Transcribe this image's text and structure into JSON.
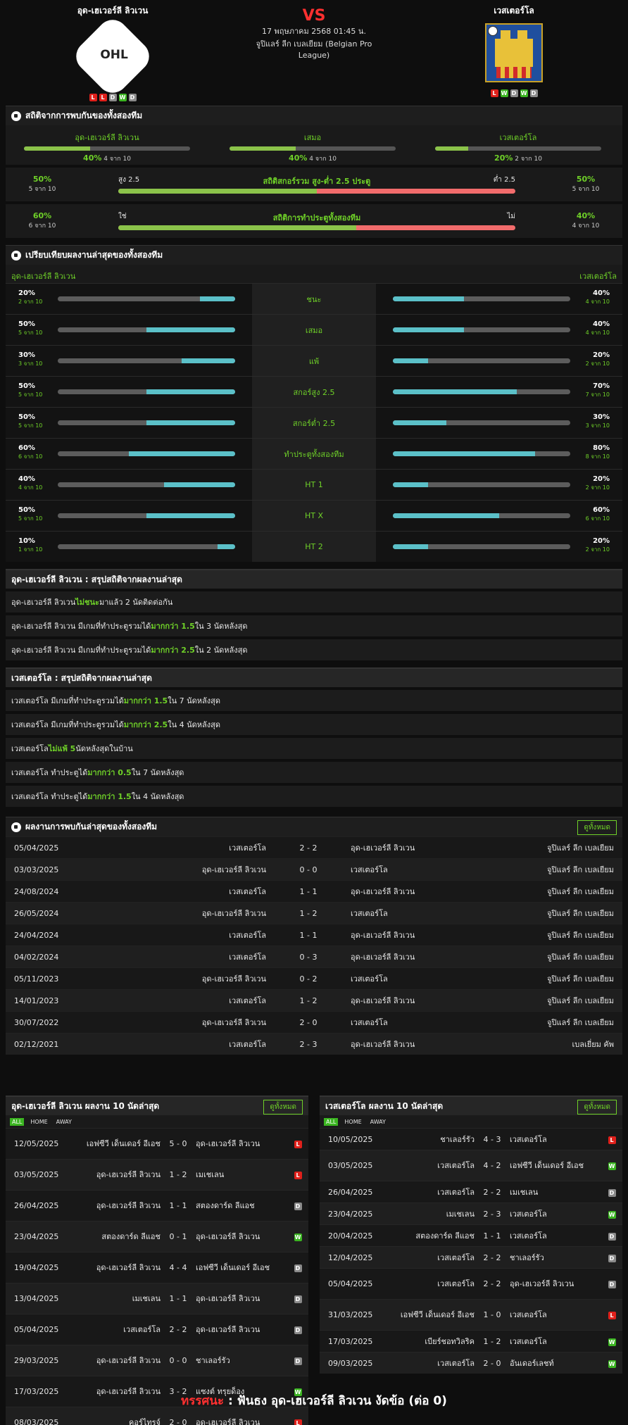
{
  "home": {
    "name": "อุด-เฮเวอร์ลี ลิวเวน",
    "logo_text": "OHL",
    "form": [
      "L",
      "L",
      "D",
      "W",
      "D"
    ]
  },
  "away": {
    "name": "เวสเตอร์โล",
    "form": [
      "L",
      "W",
      "D",
      "W",
      "D"
    ]
  },
  "match": {
    "vs": "VS",
    "date": "17 พฤษภาคม 2568 01:45 น.",
    "league": "จูปิแลร์ ลีก เบลเยียม (Belgian Pro League)"
  },
  "h2h_stats": {
    "title": "สถิติจากการพบกันของทั้งสองทีม",
    "cols": [
      {
        "label": "อุด-เฮเวอร์ลี ลิวเวน",
        "pct": "40%",
        "of": "4 จาก 10",
        "value": 0.4
      },
      {
        "label": "เสมอ",
        "pct": "40%",
        "of": "4 จาก 10",
        "value": 0.4
      },
      {
        "label": "เวสเตอร์โล",
        "pct": "20%",
        "of": "2 จาก 10",
        "value": 0.2
      }
    ],
    "ou": {
      "lp": "50%",
      "lof": "5 จาก 10",
      "rp": "50%",
      "rof": "5 จาก 10",
      "title": "สถิติสกอร์รวม สูง-ต่ำ 2.5 ประตู",
      "left": "สูง 2.5",
      "right": "ต่ำ 2.5",
      "value": 0.5
    },
    "bts": {
      "lp": "60%",
      "lof": "6 จาก 10",
      "rp": "40%",
      "rof": "4 จาก 10",
      "title": "สถิติการทำประตูทั้งสองทีม",
      "left": "ใช่",
      "right": "ไม่",
      "value": 0.6
    }
  },
  "compare": {
    "title": "เปรียบเทียบผลงานล่าสุดของทั้งสองทีม",
    "home": "อุด-เฮเวอร์ลี ลิวเวน",
    "away": "เวสเตอร์โล",
    "rows": [
      {
        "label": "ชนะ",
        "hp": "20%",
        "hof": "2 จาก 10",
        "hv": 0.2,
        "ap": "40%",
        "aof": "4 จาก 10",
        "av": 0.4
      },
      {
        "label": "เสมอ",
        "hp": "50%",
        "hof": "5 จาก 10",
        "hv": 0.5,
        "ap": "40%",
        "aof": "4 จาก 10",
        "av": 0.4
      },
      {
        "label": "แพ้",
        "hp": "30%",
        "hof": "3 จาก 10",
        "hv": 0.3,
        "ap": "20%",
        "aof": "2 จาก 10",
        "av": 0.2
      },
      {
        "label": "สกอร์สูง 2.5",
        "hp": "50%",
        "hof": "5 จาก 10",
        "hv": 0.5,
        "ap": "70%",
        "aof": "7 จาก 10",
        "av": 0.7
      },
      {
        "label": "สกอร์ต่ำ 2.5",
        "hp": "50%",
        "hof": "5 จาก 10",
        "hv": 0.5,
        "ap": "30%",
        "aof": "3 จาก 10",
        "av": 0.3
      },
      {
        "label": "ทำประตูทั้งสองทีม",
        "hp": "60%",
        "hof": "6 จาก 10",
        "hv": 0.6,
        "ap": "80%",
        "aof": "8 จาก 10",
        "av": 0.8
      },
      {
        "label": "HT 1",
        "hp": "40%",
        "hof": "4 จาก 10",
        "hv": 0.4,
        "ap": "20%",
        "aof": "2 จาก 10",
        "av": 0.2
      },
      {
        "label": "HT X",
        "hp": "50%",
        "hof": "5 จาก 10",
        "hv": 0.5,
        "ap": "60%",
        "aof": "6 จาก 10",
        "av": 0.6
      },
      {
        "label": "HT 2",
        "hp": "10%",
        "hof": "1 จาก 10",
        "hv": 0.1,
        "ap": "20%",
        "aof": "2 จาก 10",
        "av": 0.2
      }
    ]
  },
  "home_summary": {
    "title": "อุด-เฮเวอร์ลี ลิวเวน : สรุปสถิติจากผลงานล่าสุด",
    "rows": [
      [
        "อุด-เฮเวอร์ลี ลิวเวน ",
        "ไม่ชนะ",
        " มาแล้ว 2 นัดติดต่อกัน"
      ],
      [
        "อุด-เฮเวอร์ลี ลิวเวน  มีเกมที่ทำประตูรวมได้  ",
        "มากกว่า 1.5",
        "  ใน 3 นัดหลังสุด"
      ],
      [
        "อุด-เฮเวอร์ลี ลิวเวน  มีเกมที่ทำประตูรวมได้  ",
        "มากกว่า 2.5",
        "  ใน 2 นัดหลังสุด"
      ]
    ]
  },
  "away_summary": {
    "title": "เวสเตอร์โล : สรุปสถิติจากผลงานล่าสุด",
    "rows": [
      [
        "เวสเตอร์โล  มีเกมที่ทำประตูรวมได้  ",
        "มากกว่า 1.5",
        "  ใน 7 นัดหลังสุด"
      ],
      [
        "เวสเตอร์โล  มีเกมที่ทำประตูรวมได้  ",
        "มากกว่า 2.5",
        "  ใน 4 นัดหลังสุด"
      ],
      [
        "เวสเตอร์โล ",
        "ไม่แพ้ 5",
        " นัดหลังสุดในบ้าน"
      ],
      [
        "เวสเตอร์โล  ทำประตูได้  ",
        "มากกว่า 0.5",
        "  ใน 7 นัดหลังสุด"
      ],
      [
        "เวสเตอร์โล  ทำประตูได้  ",
        "มากกว่า 1.5",
        "  ใน 4 นัดหลังสุด"
      ]
    ]
  },
  "h2h_list": {
    "title": "ผลงานการพบกันล่าสุดของทั้งสองทีม",
    "btn": "ดูทั้งหมด",
    "rows": [
      [
        "05/04/2025",
        "เวสเตอร์โล",
        "2 - 2",
        "อุด-เฮเวอร์ลี ลิวเวน",
        "จูปิแลร์ ลีก เบลเยียม"
      ],
      [
        "03/03/2025",
        "อุด-เฮเวอร์ลี ลิวเวน",
        "0 - 0",
        "เวสเตอร์โล",
        "จูปิแลร์ ลีก เบลเยียม"
      ],
      [
        "24/08/2024",
        "เวสเตอร์โล",
        "1 - 1",
        "อุด-เฮเวอร์ลี ลิวเวน",
        "จูปิแลร์ ลีก เบลเยียม"
      ],
      [
        "26/05/2024",
        "อุด-เฮเวอร์ลี ลิวเวน",
        "1 - 2",
        "เวสเตอร์โล",
        "จูปิแลร์ ลีก เบลเยียม"
      ],
      [
        "24/04/2024",
        "เวสเตอร์โล",
        "1 - 1",
        "อุด-เฮเวอร์ลี ลิวเวน",
        "จูปิแลร์ ลีก เบลเยียม"
      ],
      [
        "04/02/2024",
        "เวสเตอร์โล",
        "0 - 3",
        "อุด-เฮเวอร์ลี ลิวเวน",
        "จูปิแลร์ ลีก เบลเยียม"
      ],
      [
        "05/11/2023",
        "อุด-เฮเวอร์ลี ลิวเวน",
        "0 - 2",
        "เวสเตอร์โล",
        "จูปิแลร์ ลีก เบลเยียม"
      ],
      [
        "14/01/2023",
        "เวสเตอร์โล",
        "1 - 2",
        "อุด-เฮเวอร์ลี ลิวเวน",
        "จูปิแลร์ ลีก เบลเยียม"
      ],
      [
        "30/07/2022",
        "อุด-เฮเวอร์ลี ลิวเวน",
        "2 - 0",
        "เวสเตอร์โล",
        "จูปิแลร์ ลีก เบลเยียม"
      ],
      [
        "02/12/2021",
        "เวสเตอร์โล",
        "2 - 3",
        "อุด-เฮเวอร์ลี ลิวเวน",
        "เบลเยี่ยม คัพ"
      ]
    ]
  },
  "tabs": [
    "ALL",
    "HOME",
    "AWAY"
  ],
  "home_last": {
    "title": "อุด-เฮเวอร์ลี ลิวเวน ผลงาน 10 นัดล่าสุด",
    "btn": "ดูทั้งหมด",
    "rows": [
      [
        "12/05/2025",
        "เอฟซีวี เด็นเดอร์ อีเอช",
        "5 - 0",
        "อุด-เฮเวอร์ลี ลิวเวน",
        "L"
      ],
      [
        "03/05/2025",
        "อุด-เฮเวอร์ลี ลิวเวน",
        "1 - 2",
        "เมเชเลน",
        "L"
      ],
      [
        "26/04/2025",
        "อุด-เฮเวอร์ลี ลิวเวน",
        "1 - 1",
        "สตองดาร์ด ลีแอช",
        "D"
      ],
      [
        "23/04/2025",
        "สตองดาร์ด ลีแอช",
        "0 - 1",
        "อุด-เฮเวอร์ลี ลิวเวน",
        "W"
      ],
      [
        "19/04/2025",
        "อุด-เฮเวอร์ลี ลิวเวน",
        "4 - 4",
        "เอฟซีวี เด็นเดอร์ อีเอช",
        "D"
      ],
      [
        "13/04/2025",
        "เมเชเลน",
        "1 - 1",
        "อุด-เฮเวอร์ลี ลิวเวน",
        "D"
      ],
      [
        "05/04/2025",
        "เวสเตอร์โล",
        "2 - 2",
        "อุด-เฮเวอร์ลี ลิวเวน",
        "D"
      ],
      [
        "29/03/2025",
        "อุด-เฮเวอร์ลี ลิวเวน",
        "0 - 0",
        "ชาเลอร์รัว",
        "D"
      ],
      [
        "17/03/2025",
        "อุด-เฮเวอร์ลี ลิวเวน",
        "3 - 2",
        "แซงต์ ทรุยด็อง",
        "W"
      ],
      [
        "08/03/2025",
        "คอร์ไทรจ์",
        "2 - 0",
        "อุด-เฮเวอร์ลี ลิวเวน",
        "L"
      ]
    ]
  },
  "away_last": {
    "title": "เวสเตอร์โล ผลงาน 10 นัดล่าสุด",
    "btn": "ดูทั้งหมด",
    "rows": [
      [
        "10/05/2025",
        "ชาเลอร์รัว",
        "4 - 3",
        "เวสเตอร์โล",
        "L"
      ],
      [
        "03/05/2025",
        "เวสเตอร์โล",
        "4 - 2",
        "เอฟซีวี เด็นเดอร์ อีเอช",
        "W"
      ],
      [
        "26/04/2025",
        "เวสเตอร์โล",
        "2 - 2",
        "เมเชเลน",
        "D"
      ],
      [
        "23/04/2025",
        "เมเชเลน",
        "2 - 3",
        "เวสเตอร์โล",
        "W"
      ],
      [
        "20/04/2025",
        "สตองดาร์ด ลีแอช",
        "1 - 1",
        "เวสเตอร์โล",
        "D"
      ],
      [
        "12/04/2025",
        "เวสเตอร์โล",
        "2 - 2",
        "ชาเลอร์รัว",
        "D"
      ],
      [
        "05/04/2025",
        "เวสเตอร์โล",
        "2 - 2",
        "อุด-เฮเวอร์ลี ลิวเวน",
        "D"
      ],
      [
        "31/03/2025",
        "เอฟซีวี เด็นเดอร์ อีเอช",
        "1 - 0",
        "เวสเตอร์โล",
        "L"
      ],
      [
        "17/03/2025",
        "เบียร์ชอทวิลริค",
        "1 - 2",
        "เวสเตอร์โล",
        "W"
      ],
      [
        "09/03/2025",
        "เวสเตอร์โล",
        "2 - 0",
        "อันเดอร์เลชท์",
        "W"
      ]
    ]
  },
  "verdict": {
    "k": "ทรรศนะ",
    "sep": " : ",
    "text": "ฟันธง อุด-เฮเวอร์ลี ลิวเวน งัดข้อ (ต่อ 0)"
  }
}
